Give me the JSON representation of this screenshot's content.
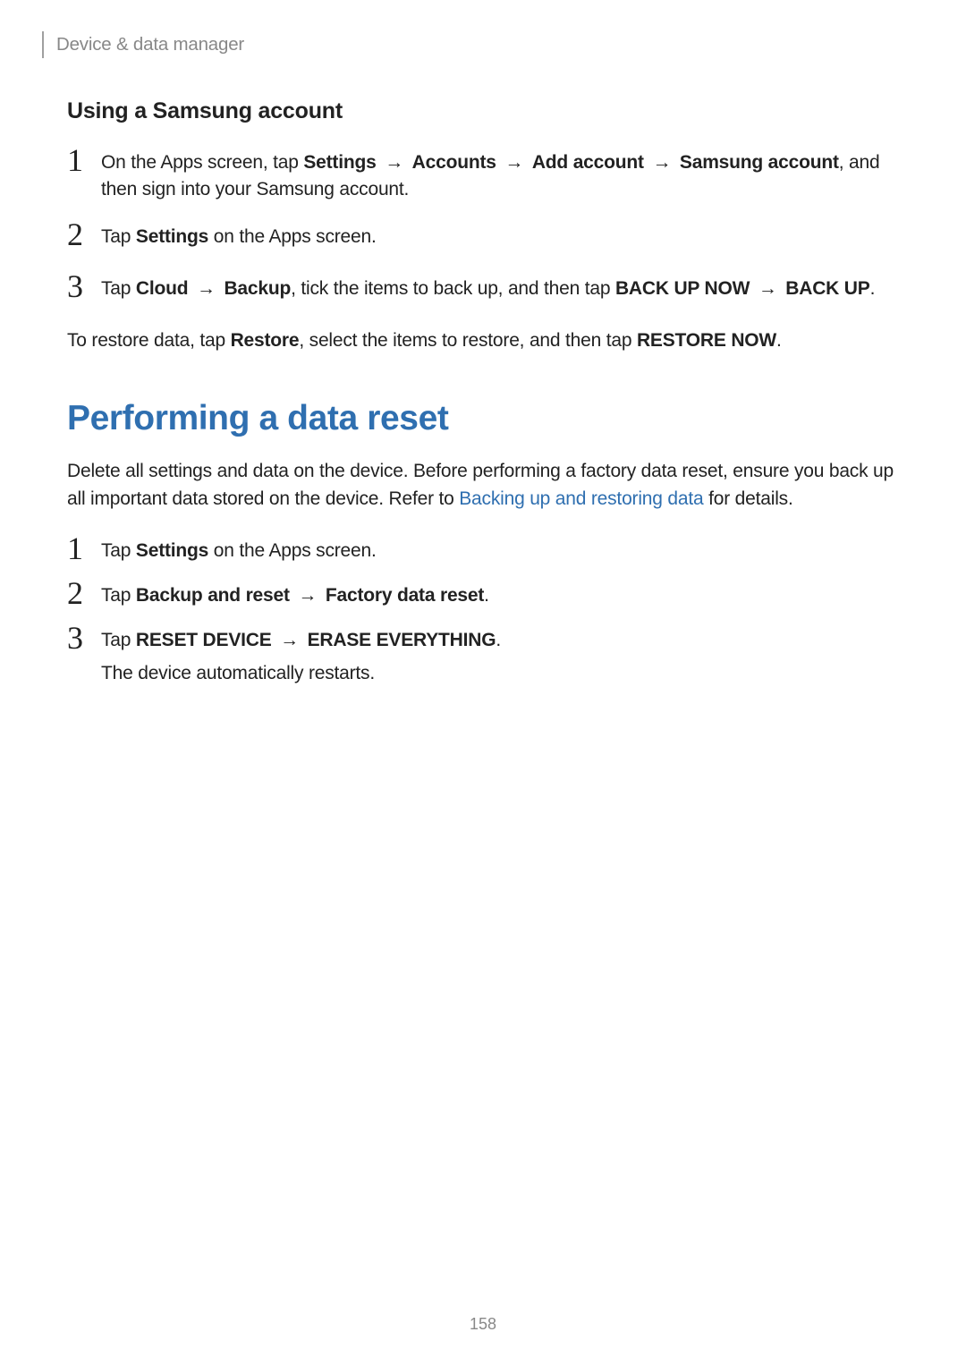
{
  "header": {
    "breadcrumb": "Device & data manager"
  },
  "section1": {
    "heading": "Using a Samsung account",
    "steps": {
      "s1": {
        "num": "1",
        "pre": "On the Apps screen, tap ",
        "b1": "Settings",
        "arr1": " → ",
        "b2": "Accounts",
        "arr2": " → ",
        "b3": "Add account",
        "arr3": " → ",
        "b4": "Samsung account",
        "post": ", and then sign into your Samsung account."
      },
      "s2": {
        "num": "2",
        "pre": "Tap ",
        "b1": "Settings",
        "post": " on the Apps screen."
      },
      "s3": {
        "num": "3",
        "pre": "Tap ",
        "b1": "Cloud",
        "arr1": " → ",
        "b2": "Backup",
        "mid": ", tick the items to back up, and then tap ",
        "b3": "BACK UP NOW",
        "arr2": " → ",
        "b4": "BACK UP",
        "post": "."
      }
    },
    "restore": {
      "pre": "To restore data, tap ",
      "b1": "Restore",
      "mid": ", select the items to restore, and then tap ",
      "b2": "RESTORE NOW",
      "post": "."
    }
  },
  "section2": {
    "title": "Performing a data reset",
    "intro": {
      "t1": "Delete all settings and data on the device. Before performing a factory data reset, ensure you back up all important data stored on the device. Refer to ",
      "link": "Backing up and restoring data",
      "t2": " for details."
    },
    "steps": {
      "s1": {
        "num": "1",
        "pre": "Tap ",
        "b1": "Settings",
        "post": " on the Apps screen."
      },
      "s2": {
        "num": "2",
        "pre": "Tap ",
        "b1": "Backup and reset",
        "arr1": " → ",
        "b2": "Factory data reset",
        "post": "."
      },
      "s3": {
        "num": "3",
        "pre": "Tap ",
        "b1": "RESET DEVICE",
        "arr1": " → ",
        "b2": "ERASE EVERYTHING",
        "post": ".",
        "after": "The device automatically restarts."
      }
    }
  },
  "page_number": "158"
}
